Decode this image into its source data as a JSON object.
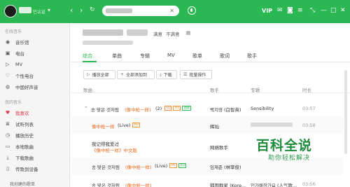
{
  "topbar": {
    "badge_text": "已认证",
    "search_placeholder": "",
    "vip": "VIP",
    "colors": {
      "brand": "#2bb853"
    }
  },
  "sidebar": {
    "online_music_title": "在线音乐",
    "online_items": [
      {
        "label": "音乐馆",
        "icon": "music-hall-icon"
      },
      {
        "label": "电台",
        "icon": "radio-icon"
      },
      {
        "label": "MV",
        "icon": "mv-icon"
      },
      {
        "label": "个性电台",
        "icon": "personal-radio-icon"
      },
      {
        "label": "中国好声音",
        "icon": "voice-icon"
      }
    ],
    "my_music_title": "我的音乐",
    "my_items": [
      {
        "label": "我喜欢",
        "icon": "heart-icon"
      },
      {
        "label": "试听列表",
        "icon": "list-icon"
      },
      {
        "label": "播放历史",
        "icon": "history-icon"
      },
      {
        "label": "本地歌曲",
        "icon": "local-icon"
      },
      {
        "label": "下载歌曲",
        "icon": "download-icon"
      },
      {
        "label": "传歌到设备",
        "icon": "device-icon"
      }
    ],
    "created_title": "我创建的歌单"
  },
  "main": {
    "satisfied": "满意",
    "not_satisfied": "不满意",
    "tabs": [
      "综合",
      "单曲",
      "专辑",
      "MV",
      "歌单",
      "歌词",
      "歌手"
    ],
    "buttons": {
      "play_all": "播放全部",
      "add_all": "全部添加到",
      "download": "下载",
      "batch": "批量操作"
    },
    "headers": {
      "song": "歌曲",
      "singer": "歌手",
      "album": "专辑",
      "duration": "时长"
    },
    "rows": [
      {
        "title": "송 맞은 것처럼",
        "paren": "(像中枪一样)",
        "extra": "(2)",
        "singer": "백지영 (白智英)",
        "album": "Sensibility",
        "duration": "03:57",
        "tags": [
          "SQ",
          "MV",
          "独家"
        ]
      },
      {
        "title": "像中枪一样",
        "paren": "(Live)",
        "extra": "",
        "singer": "辉灿",
        "album": "",
        "duration": "03:58",
        "tags": [
          "MV"
        ]
      },
      {
        "title": "我记得我爱过",
        "paren": "《像中枪一样》中文版",
        "extra": "",
        "singer": "网络歌手",
        "album": "",
        "duration": "",
        "tags": []
      },
      {
        "title": "송 맞은 것처럼",
        "paren": "(像中枪一样)",
        "extra": "(Live)",
        "singer": "임재준 (林宰俊)",
        "album": "",
        "duration": "",
        "tags": [
          "MV",
          "HQ"
        ]
      },
      {
        "title": "송 맞은 것처럼",
        "paren": "(像中枪一样)",
        "extra": "",
        "singer": "韩国群星 (Kore...",
        "album": "인가배장가요 (人气歌...",
        "duration": "03:56",
        "tags": []
      }
    ]
  },
  "watermark": {
    "title": "百科全说",
    "subtitle": "助你轻松解决"
  }
}
